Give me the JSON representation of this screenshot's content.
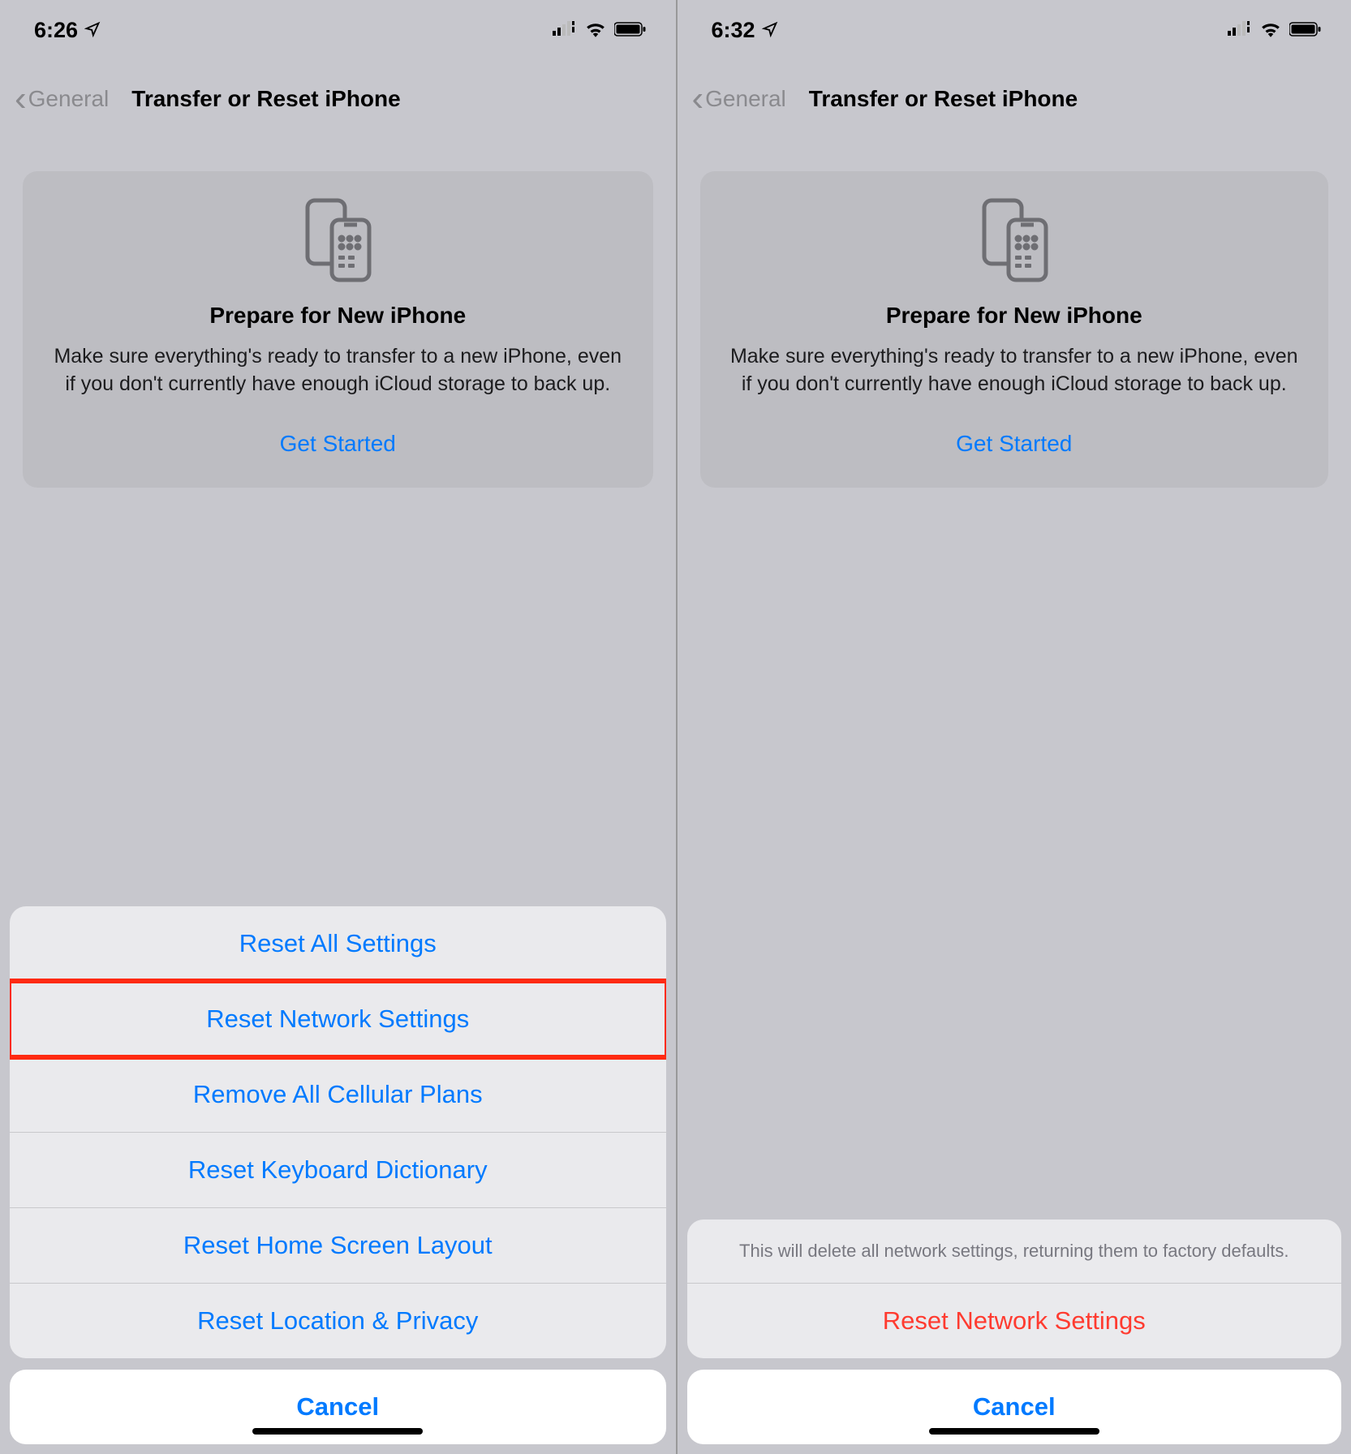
{
  "left": {
    "status": {
      "time": "6:26"
    },
    "nav": {
      "back": "General",
      "title": "Transfer or Reset iPhone"
    },
    "card": {
      "title": "Prepare for New iPhone",
      "desc": "Make sure everything's ready to transfer to a new iPhone, even if you don't currently have enough iCloud storage to back up.",
      "cta": "Get Started"
    },
    "sheet": {
      "items": [
        "Reset All Settings",
        "Reset Network Settings",
        "Remove All Cellular Plans",
        "Reset Keyboard Dictionary",
        "Reset Home Screen Layout",
        "Reset Location & Privacy"
      ],
      "highlighted_index": 1,
      "cancel": "Cancel"
    }
  },
  "right": {
    "status": {
      "time": "6:32"
    },
    "nav": {
      "back": "General",
      "title": "Transfer or Reset iPhone"
    },
    "card": {
      "title": "Prepare for New iPhone",
      "desc": "Make sure everything's ready to transfer to a new iPhone, even if you don't currently have enough iCloud storage to back up.",
      "cta": "Get Started"
    },
    "sheet": {
      "message": "This will delete all network settings, returning them to factory defaults.",
      "confirm": "Reset Network Settings",
      "cancel": "Cancel"
    }
  }
}
